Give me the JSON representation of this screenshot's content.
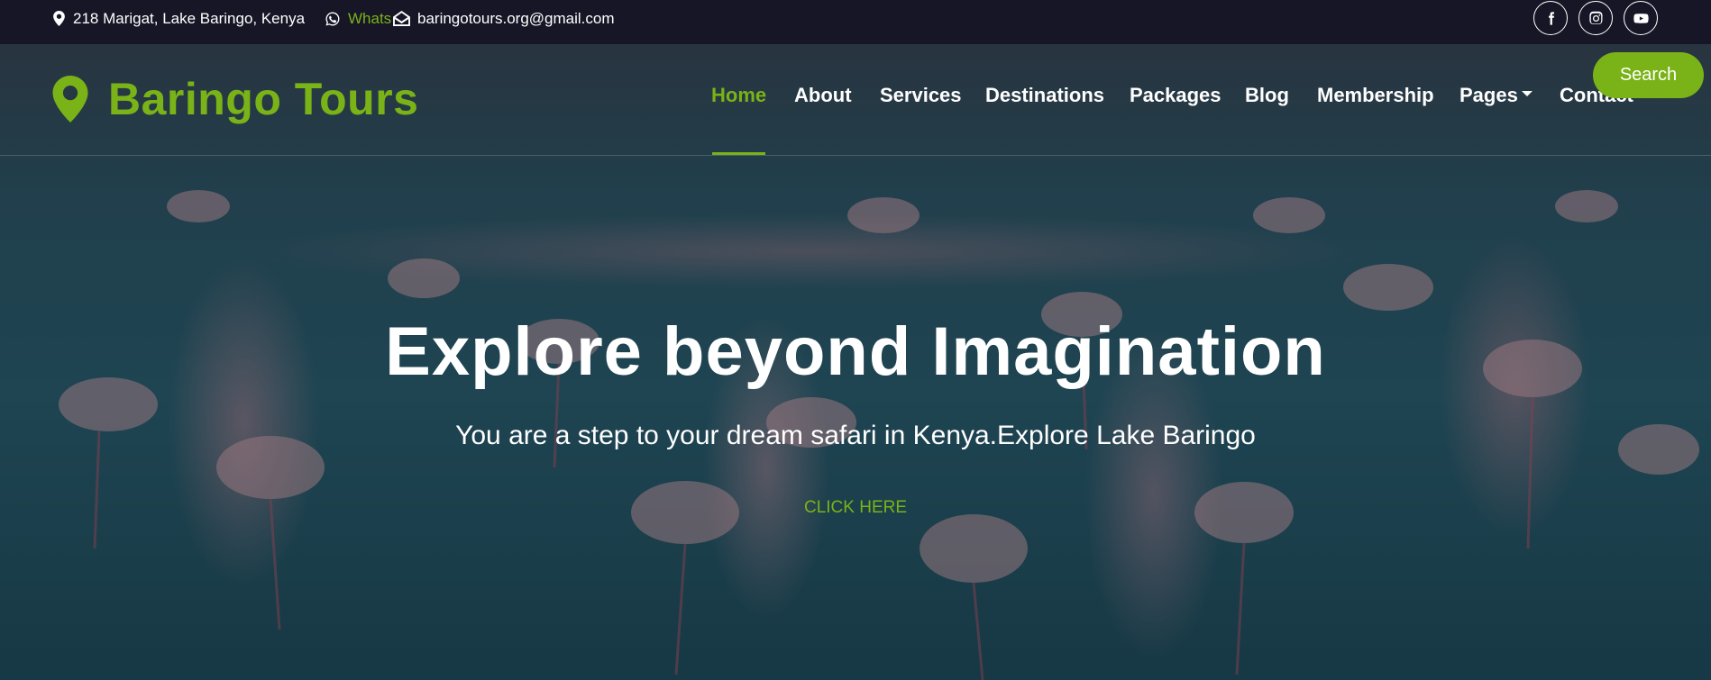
{
  "topbar": {
    "address": "218 Marigat, Lake Baringo, Kenya",
    "whatsapp": "Whats",
    "email": "baringotours.org@gmail.com",
    "social": [
      {
        "icon": "facebook-icon"
      },
      {
        "icon": "instagram-icon"
      },
      {
        "icon": "youtube-icon"
      }
    ]
  },
  "brand": {
    "name": "Baringo Tours",
    "icon": "map-marker-icon"
  },
  "nav": {
    "items": [
      "Home",
      "About",
      "Services",
      "Destinations",
      "Packages",
      "Blog",
      "Membership",
      "Pages",
      "Contact"
    ],
    "active": "Home",
    "search_label": "Search"
  },
  "hero": {
    "title": "Explore beyond Imagination",
    "subtitle": "You are a step to your dream safari in Kenya.Explore Lake Baringo",
    "cta": "CLICK HERE"
  },
  "colors": {
    "accent": "#7ab317",
    "topbar_bg": "#161626"
  }
}
